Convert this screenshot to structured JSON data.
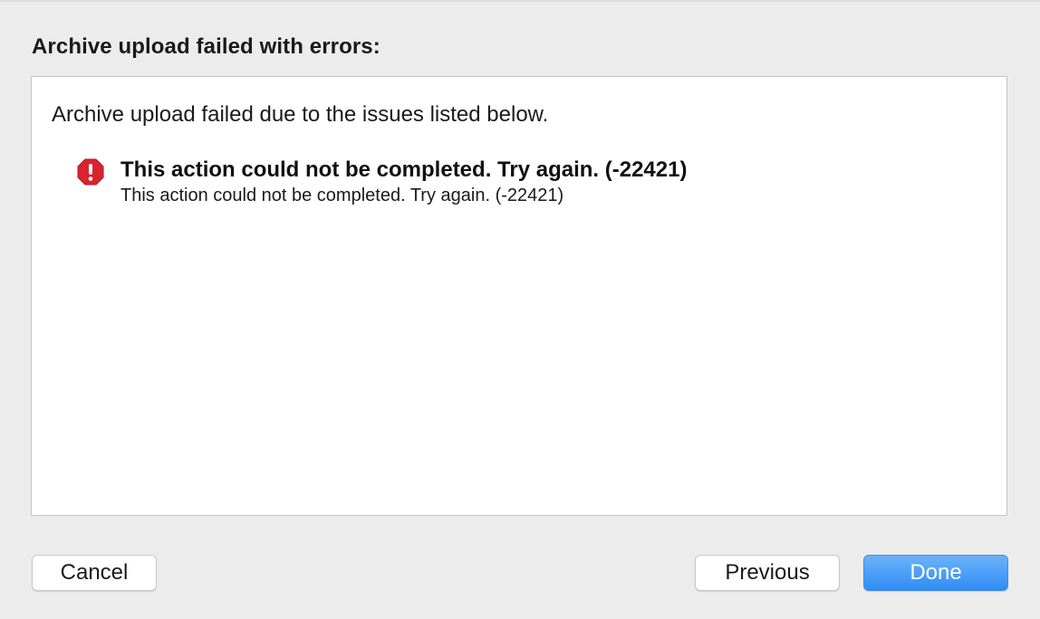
{
  "dialog": {
    "title": "Archive upload failed with errors:"
  },
  "content": {
    "summary": "Archive upload failed due to the issues listed below.",
    "issues": [
      {
        "icon": "error-octagon-icon",
        "title": "This action could not be completed. Try again. (-22421)",
        "detail": "This action could not be completed. Try again. (-22421)"
      }
    ]
  },
  "buttons": {
    "cancel": "Cancel",
    "previous": "Previous",
    "done": "Done"
  },
  "colors": {
    "background": "#ececec",
    "error_icon": "#d9232d",
    "primary_button": "#2f8cf5"
  }
}
